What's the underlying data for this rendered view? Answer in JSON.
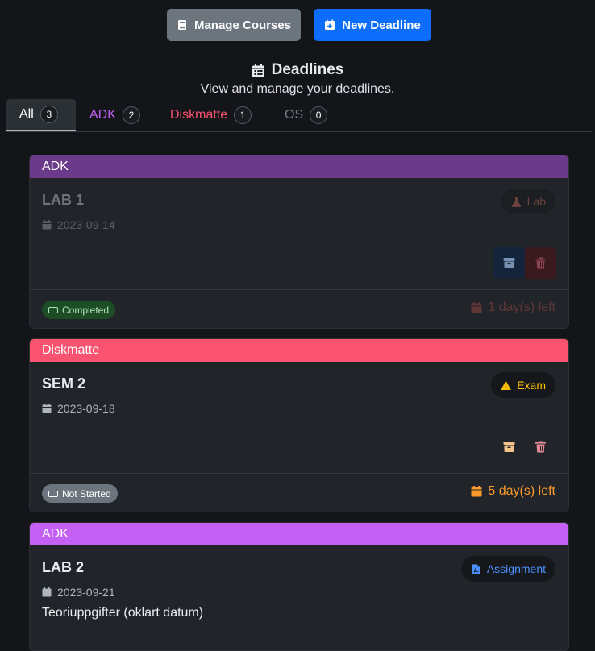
{
  "toolbar": {
    "manage_courses_label": "Manage Courses",
    "new_deadline_label": "New Deadline"
  },
  "header": {
    "title": "Deadlines",
    "subtitle": "View and manage your deadlines."
  },
  "tabs": [
    {
      "label": "All",
      "count": "3",
      "color": "#ffffff"
    },
    {
      "label": "ADK",
      "count": "2",
      "color": "#c560f5"
    },
    {
      "label": "Diskmatte",
      "count": "1",
      "color": "#fc5370"
    },
    {
      "label": "OS",
      "count": "0",
      "color": "#7b8087"
    }
  ],
  "cards": [
    {
      "course": "ADK",
      "course_color": "#6c3a8a",
      "name": "LAB 1",
      "date": "2023-09-14",
      "type_label": "Lab",
      "type_icon": "flask-icon",
      "type_color": "#e06b5c",
      "description": "",
      "status": "Completed",
      "status_bg": "#1c4d24",
      "status_color": "#b6e2b8",
      "time_left": "1 day(s) left",
      "time_color": "#c0504d",
      "completed": true
    },
    {
      "course": "Diskmatte",
      "course_color": "#fc5370",
      "name": "SEM 2",
      "date": "2023-09-18",
      "type_label": "Exam",
      "type_icon": "warning-icon",
      "type_color": "#ffc107",
      "description": "",
      "status": "Not Started",
      "status_bg": "#6c757d",
      "status_color": "#ffffff",
      "time_left": "5 day(s) left",
      "time_color": "#fd9a2a",
      "completed": false
    },
    {
      "course": "ADK",
      "course_color": "#c560f5",
      "name": "LAB 2",
      "date": "2023-09-21",
      "type_label": "Assignment",
      "type_icon": "file-pdf-icon",
      "type_color": "#4a90ff",
      "description": "Teoriuppgifter (oklart datum)",
      "status": "",
      "time_left": "",
      "completed": false
    }
  ]
}
